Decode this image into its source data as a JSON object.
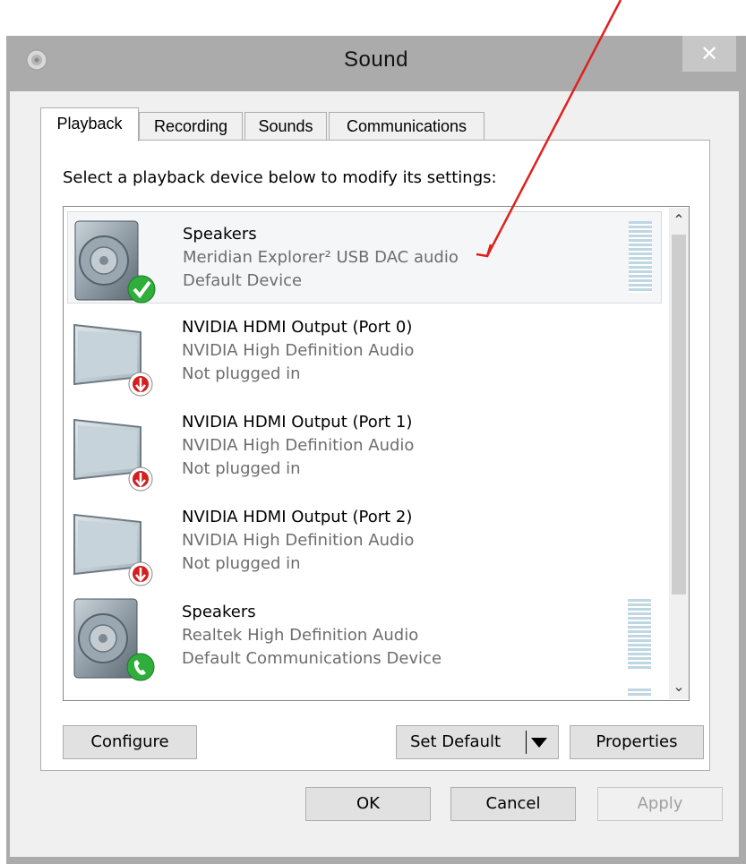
{
  "window": {
    "title": "Sound",
    "close_label": "✕"
  },
  "tabs": [
    {
      "label": "Playback",
      "active": true
    },
    {
      "label": "Recording",
      "active": false
    },
    {
      "label": "Sounds",
      "active": false
    },
    {
      "label": "Communications",
      "active": false
    }
  ],
  "instruction": "Select a playback device below to modify its settings:",
  "devices": [
    {
      "name": "Speakers",
      "driver": "Meridian Explorer² USB DAC audio",
      "status": "Default Device",
      "icon": "speaker-icon",
      "badge": "check-badge-icon",
      "selected": true
    },
    {
      "name": "NVIDIA HDMI Output (Port 0)",
      "driver": "NVIDIA High Definition Audio",
      "status": "Not plugged in",
      "icon": "monitor-icon",
      "badge": "unplugged-badge-icon",
      "selected": false
    },
    {
      "name": "NVIDIA HDMI Output (Port 1)",
      "driver": "NVIDIA High Definition Audio",
      "status": "Not plugged in",
      "icon": "monitor-icon",
      "badge": "unplugged-badge-icon",
      "selected": false
    },
    {
      "name": "NVIDIA HDMI Output (Port 2)",
      "driver": "NVIDIA High Definition Audio",
      "status": "Not plugged in",
      "icon": "monitor-icon",
      "badge": "unplugged-badge-icon",
      "selected": false
    },
    {
      "name": "Speakers",
      "driver": "Realtek High Definition Audio",
      "status": "Default Communications Device",
      "icon": "speaker-icon",
      "badge": "phone-badge-icon",
      "selected": false
    }
  ],
  "buttons": {
    "configure": "Configure",
    "set_default": "Set Default",
    "properties": "Properties",
    "ok": "OK",
    "cancel": "Cancel",
    "apply": "Apply"
  },
  "colors": {
    "annotation_arrow": "#e0201e",
    "check_badge": "#2fae3b",
    "unplugged_badge": "#d3201f",
    "meter": "#bfd6e3"
  }
}
